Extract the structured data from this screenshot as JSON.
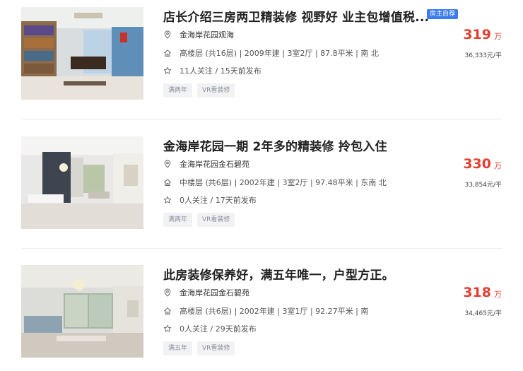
{
  "listings": [
    {
      "title": "店长介绍三房两卫精装修 视野好 业主包增值税...",
      "badge": "房主自荐",
      "community": "金海岸花园观海",
      "info": "高楼层 (共16层) | 2009年建 | 3室2厅 | 87.8平米 | 南 北",
      "follow": "11人关注 / 15天前发布",
      "tags": [
        "满两年",
        "VR看装修"
      ],
      "total_price": "319",
      "total_unit": "万",
      "unit_price": "36,333元/平"
    },
    {
      "title": "金海岸花园一期 2年多的精装修 拎包入住",
      "community": "金海岸花园金石碧苑",
      "info": "中楼层 (共6层) | 2002年建 | 3室2厅 | 97.48平米 | 东南 北",
      "follow": "0人关注 / 17天前发布",
      "tags": [
        "满两年",
        "VR看装修"
      ],
      "total_price": "330",
      "total_unit": "万",
      "unit_price": "33,854元/平"
    },
    {
      "title": "此房装修保养好，满五年唯一，户型方正。",
      "community": "金海岸花园金石碧苑",
      "info": "高楼层 (共6层) | 2002年建 | 3室1厅 | 92.27平米 | 南",
      "follow": "0人关注 / 29天前发布",
      "tags": [
        "满五年",
        "VR看装修"
      ],
      "total_price": "318",
      "total_unit": "万",
      "unit_price": "34,465元/平"
    }
  ],
  "icons": {
    "location": "location-pin-icon",
    "house": "house-icon",
    "star": "star-icon"
  },
  "colors": {
    "price": "#e43d30",
    "badge": "#3b7cf0",
    "tag_bg": "#f1f2f4"
  }
}
